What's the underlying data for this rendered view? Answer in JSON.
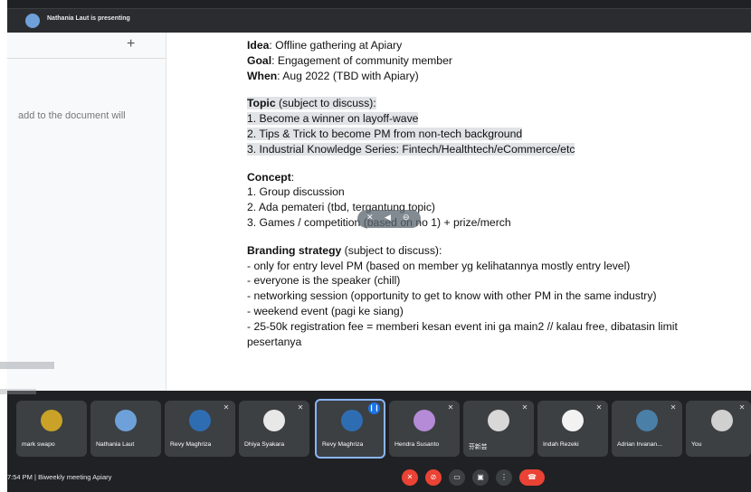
{
  "topbar": {
    "presenter_text": "Nathania Laut is presenting"
  },
  "doc_sidebar": {
    "plus": "+",
    "text": "add to the document will"
  },
  "doc": {
    "idea_label": "Idea",
    "idea_value": ": Offline gathering at Apiary",
    "goal_label": "Goal",
    "goal_value": ": Engagement of community member",
    "when_label": "When",
    "when_value": ": Aug 2022 (TBD with Apiary)",
    "topic_label": "Topic",
    "topic_note": " (subject to discuss):",
    "topics": [
      "1. Become a winner on layoff-wave",
      "2. Tips & Trick to become PM from non-tech background",
      "3. Industrial Knowledge Series: Fintech/Healthtech/eCommerce/etc"
    ],
    "concept_label": "Concept",
    "concept_colon": ":",
    "concepts": [
      "1. Group discussion",
      "2. Ada pemateri (tbd, tergantung topic)",
      "3. Games / competition (based on no 1) + prize/merch"
    ],
    "branding_label": "Branding strategy",
    "branding_note": " (subject to discuss):",
    "branding": [
      "- only for entry level PM (based on member yg kelihatannya mostly entry level)",
      "- everyone is the speaker (chill)",
      "- networking session (opportunity to get to know with other PM in the same industry)",
      "- weekend event (pagi ke siang)",
      "- 25-50k registration fee = memberi kesan event ini ga main2 // kalau free, dibatasin limit",
      "pesertanya"
    ]
  },
  "participants": [
    {
      "name": "mark swapo",
      "color": "#c9a227"
    },
    {
      "name": "Nathania Laut",
      "color": "#6ea1d9"
    },
    {
      "name": "Revy Maghriza",
      "color": "#2f6db3"
    },
    {
      "name": "Dhiya Syakara",
      "color": "#e8e8e8"
    },
    {
      "name": "Revy Maghriza",
      "color": "#2f6db3"
    },
    {
      "name": "Hendra Susanto",
      "color": "#b58ad6"
    },
    {
      "name": "芬新芸",
      "color": "#d8d8d8"
    },
    {
      "name": "Indah Rezeki",
      "color": "#f2f2f2"
    },
    {
      "name": "Adrian Irvanan...",
      "color": "#4a7fa8"
    },
    {
      "name": "You",
      "color": "#d0d0d0"
    }
  ],
  "bottombar": {
    "time": "7:54 PM",
    "separator": "|",
    "meeting": "Biweekly meeting Apiary"
  },
  "colors": {
    "accent": "#1a73e8",
    "danger": "#ea4335",
    "bar": "#202124"
  }
}
